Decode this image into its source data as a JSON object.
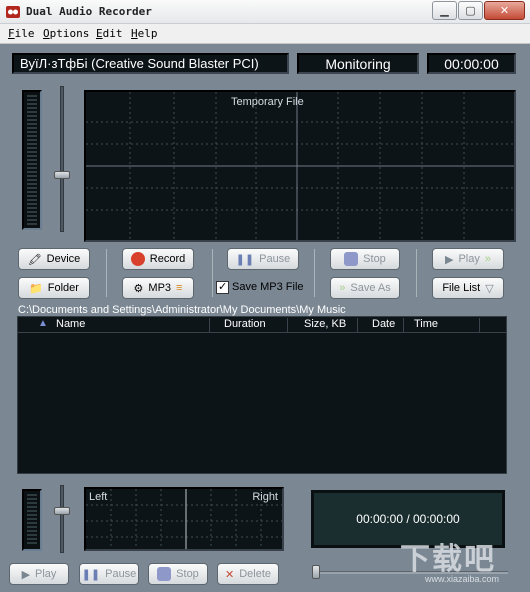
{
  "window": {
    "title": "Dual Audio Recorder"
  },
  "menu": {
    "items": [
      "File",
      "Options",
      "Edit",
      "Help"
    ]
  },
  "top": {
    "device_name": "ВуїЛ·зТфБі (Creative Sound Blaster PCI)",
    "status": "Monitoring",
    "time": "00:00:00"
  },
  "scope": {
    "label": "Temporary File"
  },
  "buttons": {
    "device": "Device",
    "record": "Record",
    "pause": "Pause",
    "stop": "Stop",
    "play": "Play",
    "folder": "Folder",
    "mp3": "MP3",
    "save_mp3": "Save MP3 File",
    "save_as": "Save As",
    "file_list": "File List"
  },
  "path": "C:\\Documents and Settings\\Administrator\\My Documents\\My Music",
  "list": {
    "columns": [
      "Name",
      "Duration",
      "Size, KB",
      "Date",
      "Time"
    ]
  },
  "player": {
    "left_label": "Left",
    "right_label": "Right",
    "time_display": "00:00:00 / 00:00:00",
    "play": "Play",
    "pause": "Pause",
    "stop": "Stop",
    "delete": "Delete"
  },
  "watermark": {
    "text": "下载吧",
    "sub": "www.xiazaiba.com"
  },
  "colors": {
    "accent_record": "#d8412b",
    "panel": "#7b8894",
    "lcd": "#0d1418"
  }
}
